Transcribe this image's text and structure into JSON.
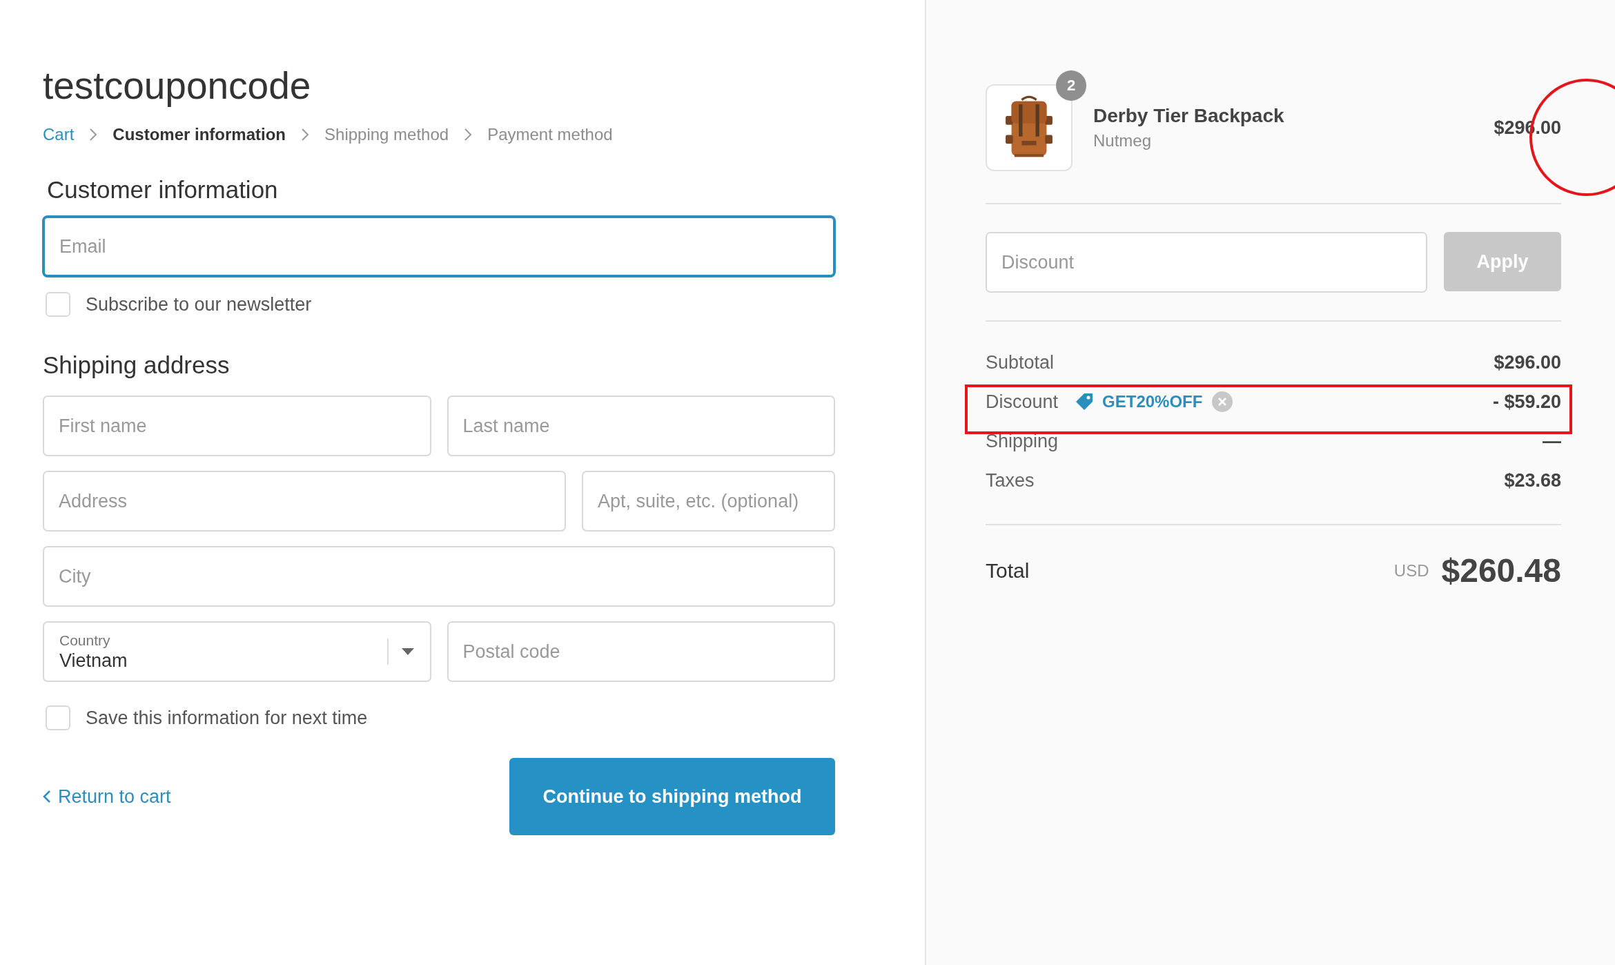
{
  "store_title": "testcouponcode",
  "breadcrumb": [
    {
      "label": "Cart",
      "kind": "link"
    },
    {
      "label": "Customer information",
      "kind": "current"
    },
    {
      "label": "Shipping method",
      "kind": "upcoming"
    },
    {
      "label": "Payment method",
      "kind": "upcoming"
    }
  ],
  "customer_section": {
    "heading": "Customer information",
    "email": {
      "placeholder": "Email",
      "focused": true
    },
    "newsletter": {
      "label": "Subscribe to our newsletter",
      "checked": false
    }
  },
  "shipping_section": {
    "heading": "Shipping address",
    "rows": [
      [
        {
          "kind": "text",
          "placeholder": "First name"
        },
        {
          "kind": "text",
          "placeholder": "Last name"
        }
      ],
      [
        {
          "kind": "text",
          "placeholder": "Address"
        },
        {
          "kind": "text",
          "placeholder": "Apt, suite, etc. (optional)"
        }
      ],
      [
        {
          "kind": "text",
          "placeholder": "City"
        }
      ],
      [
        {
          "kind": "select",
          "label": "Country",
          "value": "Vietnam"
        },
        {
          "kind": "text",
          "placeholder": "Postal code"
        }
      ]
    ]
  },
  "save_info": {
    "label": "Save this information for next time",
    "checked": false
  },
  "return_link": "Return to cart",
  "continue_button": "Continue to shipping method",
  "summary": {
    "item": {
      "kind": "picture",
      "name": "Derby Tier Backpack",
      "variant": "Nutmeg",
      "quantity": "2",
      "price": "$296.00"
    },
    "discount_field": {
      "placeholder": "Discount"
    },
    "apply_button": {
      "label": "Apply",
      "disabled": true
    },
    "lines": [
      {
        "kind": "plain",
        "label": "Subtotal",
        "value": "$296.00"
      },
      {
        "kind": "discount",
        "label": "Discount",
        "code": "GET20%OFF",
        "value": "- $59.20"
      },
      {
        "kind": "plain",
        "label": "Shipping",
        "value": "—"
      },
      {
        "kind": "plain",
        "label": "Taxes",
        "value": "$23.68"
      }
    ],
    "total": {
      "label": "Total",
      "currency": "USD",
      "value": "$260.48"
    }
  }
}
